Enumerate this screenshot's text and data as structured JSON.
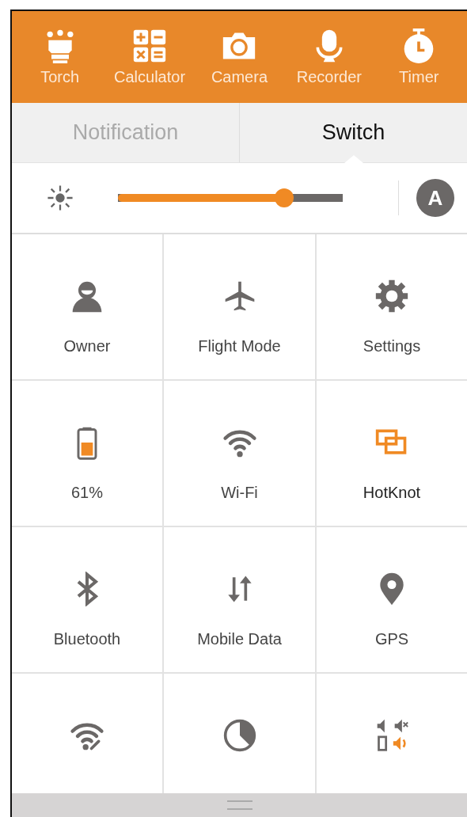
{
  "shortcuts": [
    {
      "kind": "torch",
      "label": "Torch"
    },
    {
      "kind": "calculator",
      "label": "Calculator"
    },
    {
      "kind": "camera",
      "label": "Camera"
    },
    {
      "kind": "recorder",
      "label": "Recorder"
    },
    {
      "kind": "timer",
      "label": "Timer"
    }
  ],
  "tabs": [
    {
      "label": "Notification",
      "selected": false
    },
    {
      "label": "Switch",
      "selected": true
    }
  ],
  "brightness": {
    "level": 0.74,
    "auto": true,
    "auto_label": "A"
  },
  "tiles": [
    {
      "kind": "owner",
      "label": "Owner",
      "on": false
    },
    {
      "kind": "flight",
      "label": "Flight Mode",
      "on": false
    },
    {
      "kind": "settings",
      "label": "Settings",
      "on": false
    },
    {
      "kind": "battery",
      "label": "61%",
      "on": false
    },
    {
      "kind": "wifi",
      "label": "Wi-Fi",
      "on": false
    },
    {
      "kind": "hotknot",
      "label": "HotKnot",
      "on": true
    },
    {
      "kind": "bluetooth",
      "label": "Bluetooth",
      "on": false
    },
    {
      "kind": "data",
      "label": "Mobile Data",
      "on": false
    },
    {
      "kind": "gps",
      "label": "GPS",
      "on": false
    },
    {
      "kind": "hotspot",
      "on": false
    },
    {
      "kind": "usage",
      "on": false
    },
    {
      "kind": "audio",
      "on": false
    }
  ]
}
